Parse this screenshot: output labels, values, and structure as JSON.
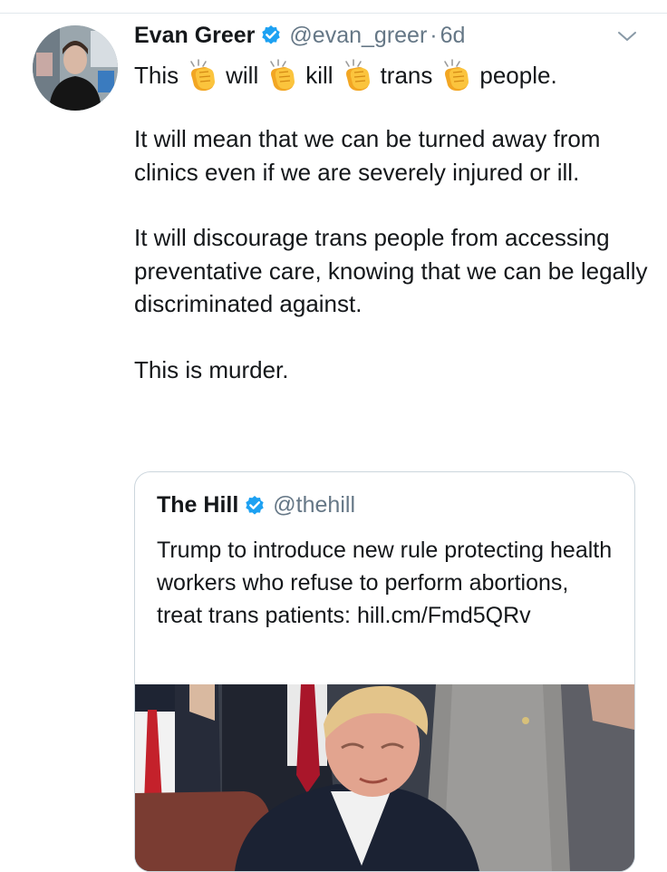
{
  "tweet": {
    "author_name": "Evan Greer",
    "handle": "@evan_greer",
    "separator": "·",
    "time": "6d",
    "line1_words": [
      "This",
      "will",
      "kill",
      "trans",
      "people."
    ],
    "paragraphs": [
      "It will mean that we can be turned away from clinics even if we are severely injured or ill.",
      "It will discourage trans people from accessing preventative care, knowing that we can be legally discriminated against.",
      "This is murder."
    ]
  },
  "quote": {
    "author_name": "The Hill",
    "handle": "@thehill",
    "text": "Trump to introduce new rule protecting health workers who refuse to perform abortions, treat trans patients: hill.cm/Fmd5QRv"
  },
  "colors": {
    "verified": "#1da1f2",
    "secondary_text": "#657786",
    "border": "#ccd6dd",
    "clap_emoji": "#f5b731"
  },
  "icons": {
    "verified": "verified-badge-icon",
    "menu": "chevron-down-icon",
    "emoji": "clapping-hands-emoji"
  }
}
